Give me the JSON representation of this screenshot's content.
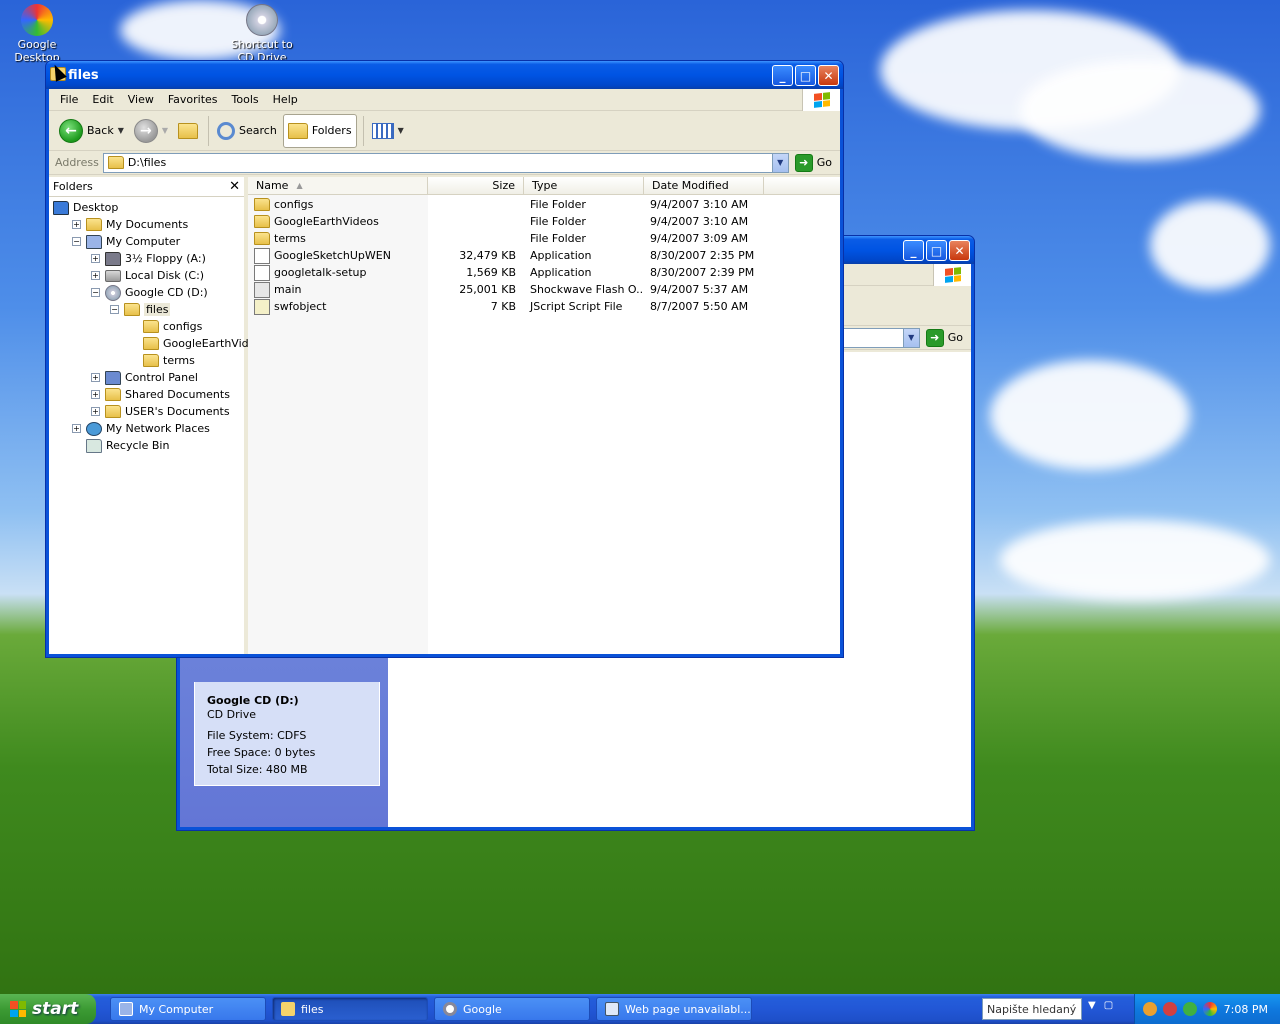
{
  "desktop": {
    "icons": [
      {
        "label": "Google Desktop",
        "icon": "google-desktop-icon"
      },
      {
        "label": "Shortcut to CD Drive",
        "icon": "cd-drive-shortcut-icon"
      }
    ]
  },
  "back_window": {
    "address_go": "Go",
    "details": {
      "name": "Google CD (D:)",
      "kind": "CD Drive",
      "file_system": "File System: CDFS",
      "free_space": "Free Space: 0 bytes",
      "total_size": "Total Size: 480 MB"
    }
  },
  "window": {
    "title": "files",
    "menu": [
      "File",
      "Edit",
      "View",
      "Favorites",
      "Tools",
      "Help"
    ],
    "toolbar": {
      "back": "Back",
      "search": "Search",
      "folders": "Folders"
    },
    "address": {
      "label": "Address",
      "value": "D:\\files",
      "go": "Go"
    },
    "folders_pane": {
      "title": "Folders",
      "tree": [
        {
          "label": "Desktop",
          "depth": 0,
          "expander": "",
          "icon": "desktop"
        },
        {
          "label": "My Documents",
          "depth": 1,
          "expander": "+",
          "icon": "folder"
        },
        {
          "label": "My Computer",
          "depth": 1,
          "expander": "−",
          "icon": "computer"
        },
        {
          "label": "3½ Floppy (A:)",
          "depth": 2,
          "expander": "+",
          "icon": "floppy"
        },
        {
          "label": "Local Disk (C:)",
          "depth": 2,
          "expander": "+",
          "icon": "drive"
        },
        {
          "label": "Google CD (D:)",
          "depth": 2,
          "expander": "−",
          "icon": "cd"
        },
        {
          "label": "files",
          "depth": 3,
          "expander": "−",
          "icon": "folder",
          "selected": true
        },
        {
          "label": "configs",
          "depth": 4,
          "expander": "",
          "icon": "folder"
        },
        {
          "label": "GoogleEarthVideos",
          "depth": 4,
          "expander": "",
          "icon": "folder"
        },
        {
          "label": "terms",
          "depth": 4,
          "expander": "",
          "icon": "folder"
        },
        {
          "label": "Control Panel",
          "depth": 2,
          "expander": "+",
          "icon": "control"
        },
        {
          "label": "Shared Documents",
          "depth": 2,
          "expander": "+",
          "icon": "folder"
        },
        {
          "label": "USER's Documents",
          "depth": 2,
          "expander": "+",
          "icon": "folder"
        },
        {
          "label": "My Network Places",
          "depth": 1,
          "expander": "+",
          "icon": "network"
        },
        {
          "label": "Recycle Bin",
          "depth": 1,
          "expander": "",
          "icon": "recycle"
        }
      ]
    },
    "file_list": {
      "columns": {
        "name": "Name",
        "size": "Size",
        "type": "Type",
        "date": "Date Modified"
      },
      "rows": [
        {
          "name": "configs",
          "size": "",
          "type": "File Folder",
          "date": "9/4/2007 3:10 AM",
          "icon": "folder"
        },
        {
          "name": "GoogleEarthVideos",
          "size": "",
          "type": "File Folder",
          "date": "9/4/2007 3:10 AM",
          "icon": "folder"
        },
        {
          "name": "terms",
          "size": "",
          "type": "File Folder",
          "date": "9/4/2007 3:09 AM",
          "icon": "folder"
        },
        {
          "name": "GoogleSketchUpWEN",
          "size": "32,479 KB",
          "type": "Application",
          "date": "8/30/2007 2:35 PM",
          "icon": "app"
        },
        {
          "name": "googletalk-setup",
          "size": "1,569 KB",
          "type": "Application",
          "date": "8/30/2007 2:39 PM",
          "icon": "app"
        },
        {
          "name": "main",
          "size": "25,001 KB",
          "type": "Shockwave Flash O...",
          "date": "9/4/2007 5:37 AM",
          "icon": "flash"
        },
        {
          "name": "swfobject",
          "size": "7 KB",
          "type": "JScript Script File",
          "date": "8/7/2007 5:50 AM",
          "icon": "script"
        }
      ]
    }
  },
  "taskbar": {
    "start": "start",
    "tasks": [
      {
        "label": "My Computer",
        "active": false
      },
      {
        "label": "files",
        "active": true
      },
      {
        "label": "Google",
        "active": false
      },
      {
        "label": "Web page unavailabl...",
        "active": false
      }
    ],
    "search_placeholder": "Napište hledaný ...",
    "clock": "7:08 PM"
  },
  "colors": {
    "xp_blue": "#0054e3",
    "start_green": "#3c9b34",
    "tray_blue": "#0f79df"
  }
}
